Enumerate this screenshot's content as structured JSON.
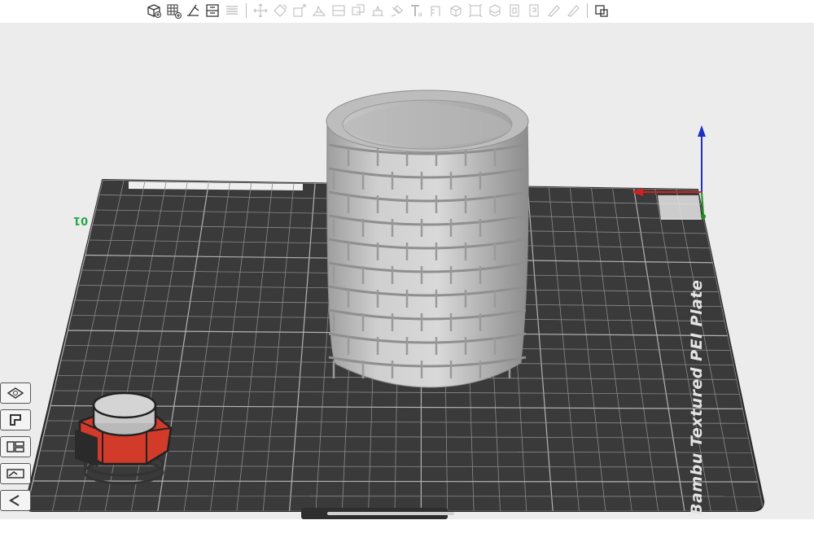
{
  "toolbar": {
    "items": [
      {
        "icon": "add-object-icon",
        "enabled": true
      },
      {
        "icon": "add-plate-icon",
        "enabled": true
      },
      {
        "icon": "auto-orient-icon",
        "enabled": true
      },
      {
        "icon": "arrange-icon",
        "enabled": true
      },
      {
        "icon": "split-plates-icon",
        "enabled": false
      },
      {
        "sep": true
      },
      {
        "icon": "move-icon",
        "enabled": false
      },
      {
        "icon": "rotate-icon",
        "enabled": false
      },
      {
        "icon": "scale-icon",
        "enabled": false
      },
      {
        "icon": "lay-on-face-icon",
        "enabled": false
      },
      {
        "icon": "cut-icon",
        "enabled": false
      },
      {
        "icon": "mesh-boolean-icon",
        "enabled": false
      },
      {
        "icon": "support-paint-icon",
        "enabled": false
      },
      {
        "icon": "seam-paint-icon",
        "enabled": false
      },
      {
        "icon": "text-emboss-icon",
        "enabled": false
      },
      {
        "icon": "measure-icon",
        "enabled": false
      },
      {
        "icon": "assembly-icon",
        "enabled": false
      },
      {
        "icon": "split-objects-icon",
        "enabled": false
      },
      {
        "icon": "split-parts-icon",
        "enabled": false
      },
      {
        "icon": "variable-layer-height-icon",
        "enabled": false
      },
      {
        "icon": "fuzzy-skin-icon",
        "enabled": false
      },
      {
        "icon": "brim-ears-icon",
        "enabled": false
      },
      {
        "icon": "color-paint-icon",
        "enabled": false
      },
      {
        "sep": true
      },
      {
        "icon": "view-settings-icon",
        "enabled": true
      }
    ]
  },
  "plate": {
    "label": "Bambu Textured PEI Plate",
    "number": "01"
  },
  "left_tools": [
    {
      "icon": "view-orientation-icon"
    },
    {
      "icon": "object-list-icon"
    },
    {
      "icon": "layout-icon"
    },
    {
      "icon": "plate-settings-icon"
    },
    {
      "icon": "collapse-icon"
    }
  ],
  "colors": {
    "plate": "#3a3a3a",
    "grid": "#9a9a9a",
    "background": "#ececec",
    "model": "#c4c4c4",
    "nut_red": "#d23a2a",
    "axis_x": "#d42020",
    "axis_y": "#1e8c1e",
    "axis_z": "#1e2fc8",
    "plate_number": "#27a846"
  }
}
